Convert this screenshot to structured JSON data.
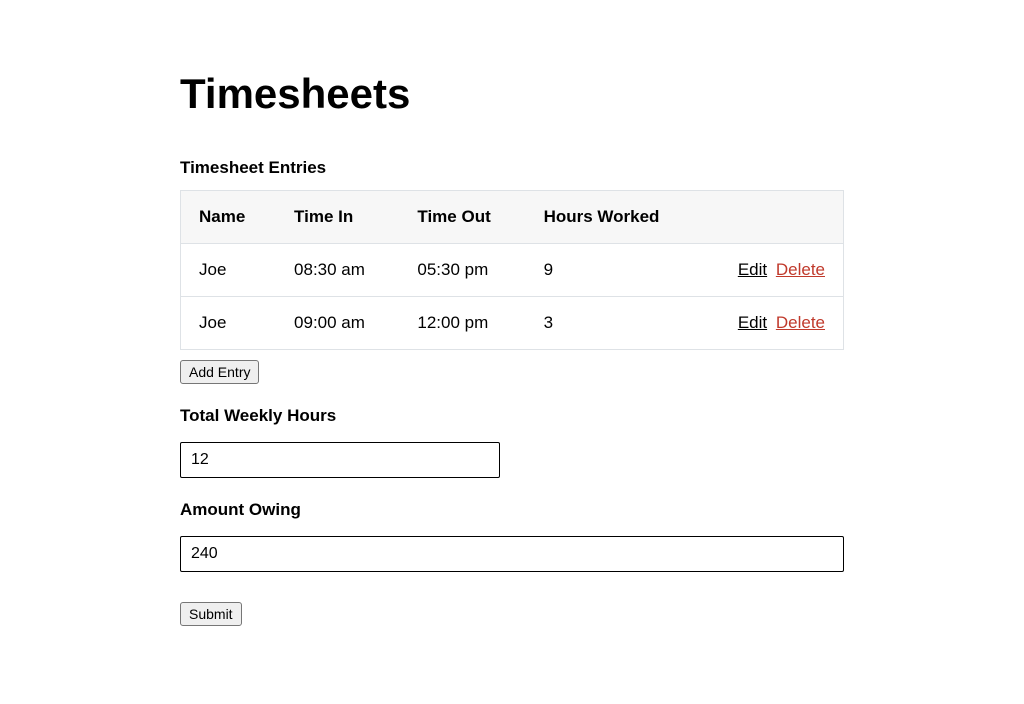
{
  "page_title": "Timesheets",
  "entries_section_label": "Timesheet Entries",
  "columns": {
    "name": "Name",
    "time_in": "Time In",
    "time_out": "Time Out",
    "hours_worked": "Hours Worked"
  },
  "rows": [
    {
      "name": "Joe",
      "time_in": "08:30 am",
      "time_out": "05:30 pm",
      "hours_worked": "9"
    },
    {
      "name": "Joe",
      "time_in": "09:00 am",
      "time_out": "12:00 pm",
      "hours_worked": "3"
    }
  ],
  "actions": {
    "edit": "Edit",
    "delete": "Delete"
  },
  "add_entry_label": "Add Entry",
  "total_hours": {
    "label": "Total Weekly Hours",
    "value": "12"
  },
  "amount_owing": {
    "label": "Amount Owing",
    "value": "240"
  },
  "submit_label": "Submit"
}
